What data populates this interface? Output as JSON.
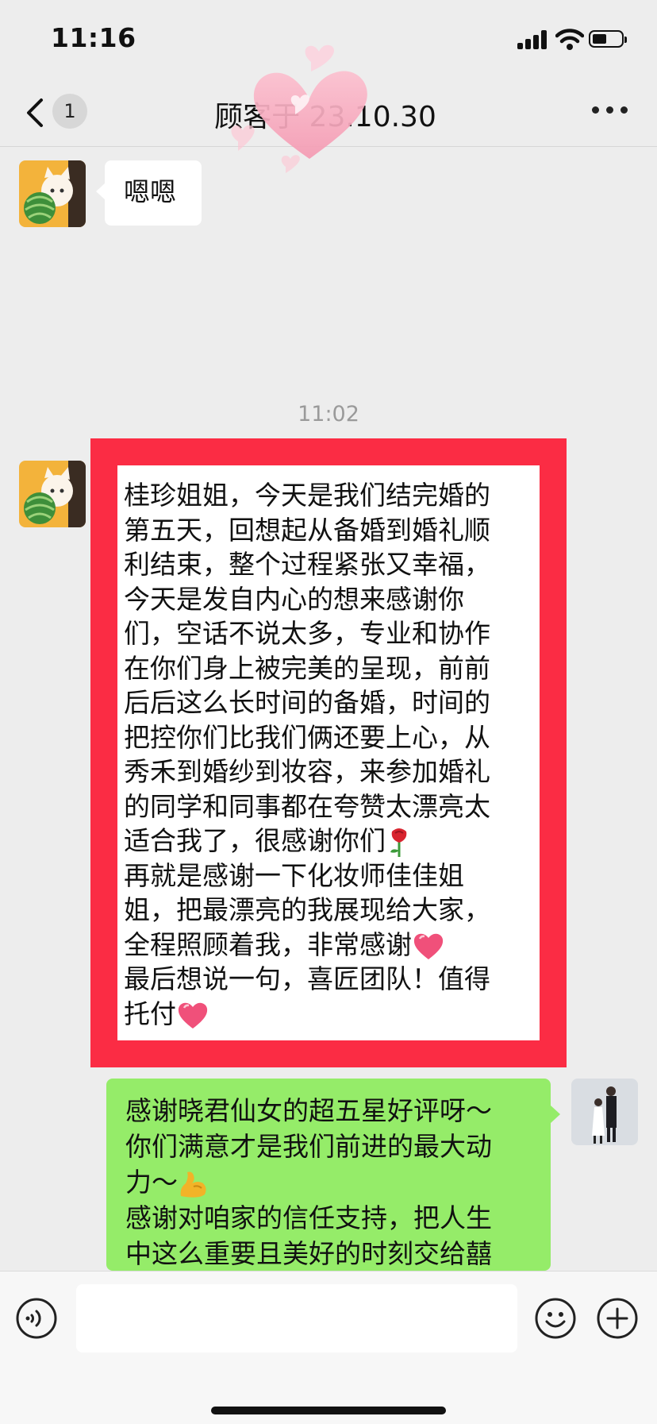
{
  "status_bar": {
    "time": "11:16"
  },
  "nav": {
    "back_badge": "1",
    "title": "顾客于 23.10.30",
    "more_label": "•••"
  },
  "messages": [
    {
      "side": "left",
      "text": "嗯嗯"
    },
    {
      "timestamp": "11:02"
    },
    {
      "side": "left",
      "highlighted": true,
      "lines": [
        "桂珍姐姐，今天是我们结完婚的",
        "第五天，回想起从备婚到婚礼顺",
        "利结束，整个过程紧张又幸福，",
        "今天是发自内心的想来感谢你",
        "们，空话不说太多，专业和协作",
        "在你们身上被完美的呈现，前前",
        "后后这么长时间的备婚，时间的",
        "把控你们比我们俩还要上心，从",
        "秀禾到婚纱到妆容，来参加婚礼",
        "的同学和同事都在夸赞太漂亮太",
        "适合我了，很感谢你们",
        "再就是感谢一下化妆师佳佳姐",
        "姐，把最漂亮的我展现给大家，",
        "全程照顾着我，非常感谢",
        "最后想说一句，喜匠团队！值得",
        "托付"
      ],
      "emoji": {
        "after_line_11": "rose",
        "after_line_14": "heart",
        "after_line_16": "heart"
      }
    },
    {
      "side": "right",
      "lines": [
        "感谢晓君仙女的超五星好评呀～",
        "你们满意才是我们前进的最大动",
        "力～",
        "感谢对咱家的信任支持，把人生",
        "中这么重要且美好的时刻交给囍"
      ],
      "emoji": {
        "after_line_3": "flexed-biceps"
      }
    }
  ],
  "input_bar": {
    "placeholder": ""
  },
  "colors": {
    "highlight_frame": "#fb2c44",
    "outgoing_bubble": "#95ec69",
    "heart": "#f5a3bb"
  }
}
